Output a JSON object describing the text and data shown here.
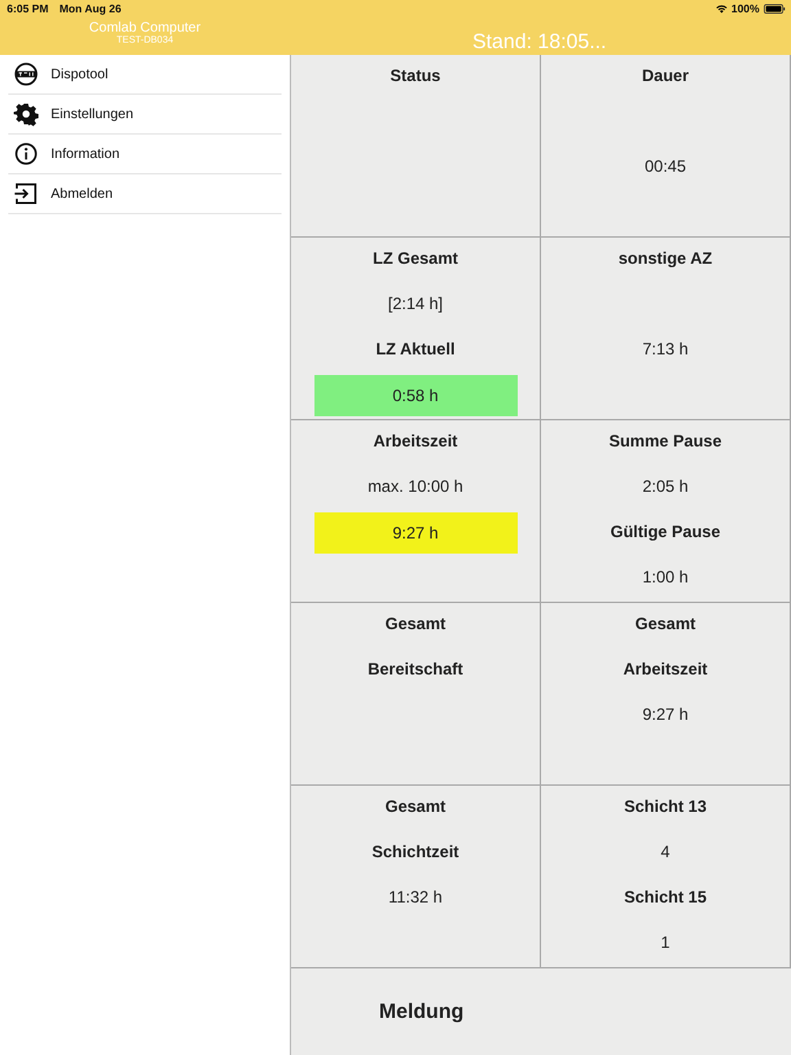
{
  "status_bar": {
    "time": "6:05 PM",
    "date": "Mon Aug 26",
    "battery": "100%"
  },
  "sidebar": {
    "title": "Comlab Computer",
    "subtitle": "TEST-DB034",
    "items": [
      {
        "label": "Dispotool",
        "kind": "logo"
      },
      {
        "label": "Einstellungen",
        "kind": "gear"
      },
      {
        "label": "Information",
        "kind": "info"
      },
      {
        "label": "Abmelden",
        "kind": "exit"
      }
    ]
  },
  "header": {
    "title": "Stand: 18:05..."
  },
  "cells": [
    {
      "lines": [
        {
          "kind": "label",
          "text": "Status"
        }
      ]
    },
    {
      "lines": [
        {
          "kind": "label",
          "text": "Dauer"
        },
        {
          "kind": "gap"
        },
        {
          "kind": "value",
          "text": "00:45"
        }
      ]
    },
    {
      "lines": [
        {
          "kind": "label",
          "text": "LZ Gesamt"
        },
        {
          "kind": "value",
          "text": "[2:14 h]"
        },
        {
          "kind": "label",
          "text": "LZ Aktuell"
        },
        {
          "kind": "value",
          "text": "0:58 h",
          "color": "#80ef80"
        }
      ]
    },
    {
      "lines": [
        {
          "kind": "label",
          "text": "sonstige AZ"
        },
        {
          "kind": "gap"
        },
        {
          "kind": "value",
          "text": "7:13 h"
        }
      ]
    },
    {
      "lines": [
        {
          "kind": "label",
          "text": "Arbeitszeit"
        },
        {
          "kind": "value",
          "text": "max. 10:00 h"
        },
        {
          "kind": "value",
          "text": "9:27 h",
          "color": "#f2f21a"
        }
      ]
    },
    {
      "lines": [
        {
          "kind": "label",
          "text": "Summe Pause"
        },
        {
          "kind": "value",
          "text": "2:05 h"
        },
        {
          "kind": "label",
          "text": "Gültige Pause"
        },
        {
          "kind": "value",
          "text": "1:00 h"
        }
      ]
    },
    {
      "lines": [
        {
          "kind": "label",
          "text": "Gesamt"
        },
        {
          "kind": "label",
          "text": "Bereitschaft"
        }
      ]
    },
    {
      "lines": [
        {
          "kind": "label",
          "text": "Gesamt"
        },
        {
          "kind": "label",
          "text": "Arbeitszeit"
        },
        {
          "kind": "value",
          "text": "9:27 h"
        }
      ]
    },
    {
      "lines": [
        {
          "kind": "label",
          "text": "Gesamt"
        },
        {
          "kind": "label",
          "text": "Schichtzeit"
        },
        {
          "kind": "value",
          "text": "11:32 h"
        }
      ]
    },
    {
      "lines": [
        {
          "kind": "label",
          "text": "Schicht 13"
        },
        {
          "kind": "value",
          "text": "4"
        },
        {
          "kind": "label",
          "text": "Schicht 15"
        },
        {
          "kind": "value",
          "text": "1"
        }
      ]
    }
  ],
  "footer": {
    "label": "Meldung"
  }
}
